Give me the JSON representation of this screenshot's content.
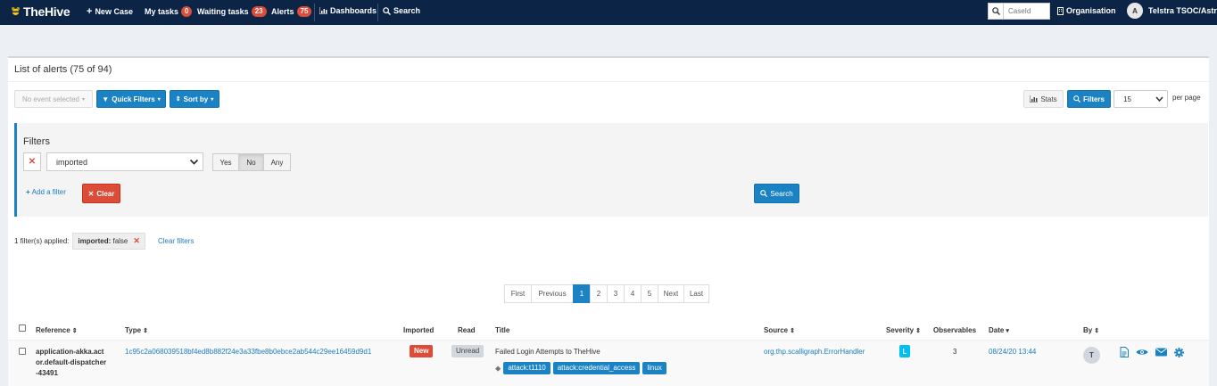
{
  "nav": {
    "brand": "TheHive",
    "new_case": "New Case",
    "my_tasks": "My tasks",
    "my_tasks_count": "0",
    "waiting_tasks": "Waiting tasks",
    "waiting_tasks_count": "23",
    "alerts": "Alerts",
    "alerts_count": "75",
    "dashboards": "Dashboards",
    "search": "Search",
    "caseid_placeholder": "CaseId",
    "organisation": "Organisation",
    "user_initial": "A",
    "user_name": "Telstra TSOC/Astrid"
  },
  "panel": {
    "title": "List of alerts (75 of 94)",
    "event_selector": "No event selected",
    "quick_filters": "Quick Filters",
    "sort_by": "Sort by",
    "stats": "Stats",
    "filters": "Filters",
    "per_page_value": "15",
    "per_page_label": "per page"
  },
  "filters": {
    "title": "Filters",
    "field": "imported",
    "options": [
      "Yes",
      "No",
      "Any"
    ],
    "selected_option": "No",
    "add_filter": "Add a filter",
    "clear": "Clear",
    "search": "Search"
  },
  "applied": {
    "text": "1 filter(s) applied:",
    "chip_key": "imported:",
    "chip_value": "false",
    "clear_filters": "Clear filters"
  },
  "pagination": {
    "first": "First",
    "previous": "Previous",
    "pages": [
      "1",
      "2",
      "3",
      "4",
      "5"
    ],
    "current": "1",
    "next": "Next",
    "last": "Last"
  },
  "table": {
    "headers": {
      "reference": "Reference",
      "type": "Type",
      "imported": "Imported",
      "read": "Read",
      "title": "Title",
      "source": "Source",
      "severity": "Severity",
      "observables": "Observables",
      "date": "Date",
      "by": "By"
    },
    "rows": [
      {
        "reference_line1": "application-akka.act",
        "reference_line2": "or.default-dispatcher",
        "reference_line3": "-43491",
        "type": "1c95c2a068039518bf4ed8b882f24e3a33fbe8b0ebce2ab544c29ee16459d9d1",
        "imported": "New",
        "read": "Unread",
        "title": "Failed Login Attempts to TheHive",
        "tags": [
          "attack:t1110",
          "attack:credential_access",
          "linux"
        ],
        "source": "org.thp.scalligraph.ErrorHandler",
        "severity": "L",
        "observables": "3",
        "date": "08/24/20 13:44",
        "by": "T"
      }
    ]
  },
  "colors": {
    "navbar": "#0c2445",
    "primary": "#1b82c4",
    "danger": "#dd4b39",
    "severity_low": "#00c0ef"
  }
}
